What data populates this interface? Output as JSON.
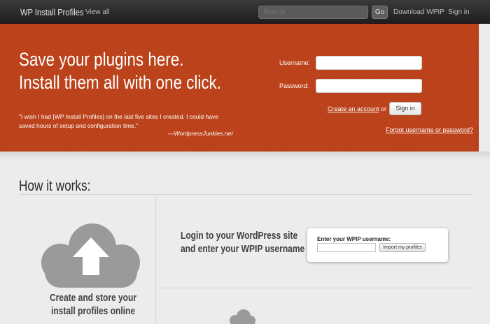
{
  "topbar": {
    "brand": "WP Install Profiles",
    "view_all": "View all",
    "search_placeholder": "Search",
    "go_label": "Go",
    "download_label": "Download WPIP",
    "signin_label": "Sign in"
  },
  "hero": {
    "headline_line1": "Save your plugins here.",
    "headline_line2": "Install them all with one click.",
    "quote_line1": "\"I wish I had [WP Install Profiles] on the last five sites I created. I could have",
    "quote_line2": "saved hours of setup and configuration time.\"",
    "quote_author": "—WordpressJunkies.net"
  },
  "login": {
    "username_label": "Username:",
    "password_label": "Password:",
    "username_value": "",
    "password_value": "",
    "create_account": "Create an account",
    "or_text": "or",
    "signin_button": "Sign in",
    "forgot_link": "Forgot username or password?"
  },
  "how": {
    "title": "How it works:",
    "step1_line1": "Create and store your",
    "step1_line2": "install profiles online",
    "step2_line1": "Login to your WordPress site",
    "step2_line2": "and enter your WPIP username",
    "card_label": "Enter your WPIP username:",
    "card_input_value": "",
    "card_button": "Import my profiles"
  },
  "colors": {
    "hero_bg": "#c0441c",
    "topbar_bg": "#2a2a2a",
    "page_bg": "#ececec",
    "icon_gray": "#9a9a9a"
  },
  "icons": [
    "cloud-upload-icon",
    "cloud-icon"
  ]
}
